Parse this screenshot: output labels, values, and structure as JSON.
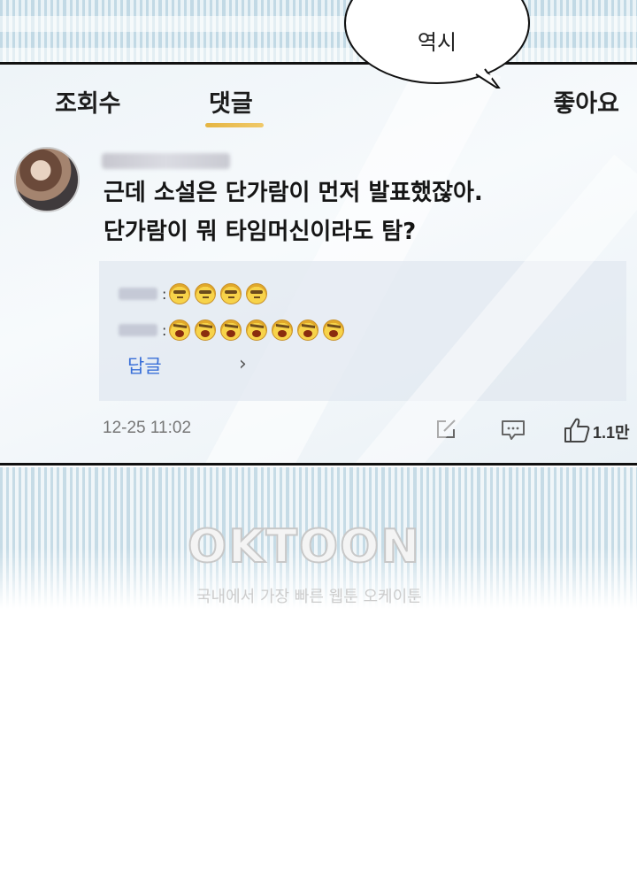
{
  "tabs": {
    "views": "조회수",
    "comments": "댓글",
    "likes": "좋아요"
  },
  "speech_bubble": {
    "text": "역시"
  },
  "comment": {
    "line1": "근데 소설은 단가람이 먼저 발표했잖아.",
    "line2": "단가람이 뭐 타임머신이라도 탐?",
    "timestamp": "12-25 11:02",
    "like_count": "1.1만"
  },
  "replies": {
    "row1_emojis": [
      "cool-face",
      "cool-face",
      "cool-face",
      "cool-face"
    ],
    "row2_emojis": [
      "angry-face",
      "angry-face",
      "angry-face",
      "angry-face",
      "angry-face",
      "angry-face",
      "angry-face"
    ],
    "reply_link": "답글",
    "chevron": "›"
  },
  "watermark": {
    "logo": "OKTOON",
    "tagline": "국내에서 가장 빠른 웹툰 오케이툰"
  }
}
